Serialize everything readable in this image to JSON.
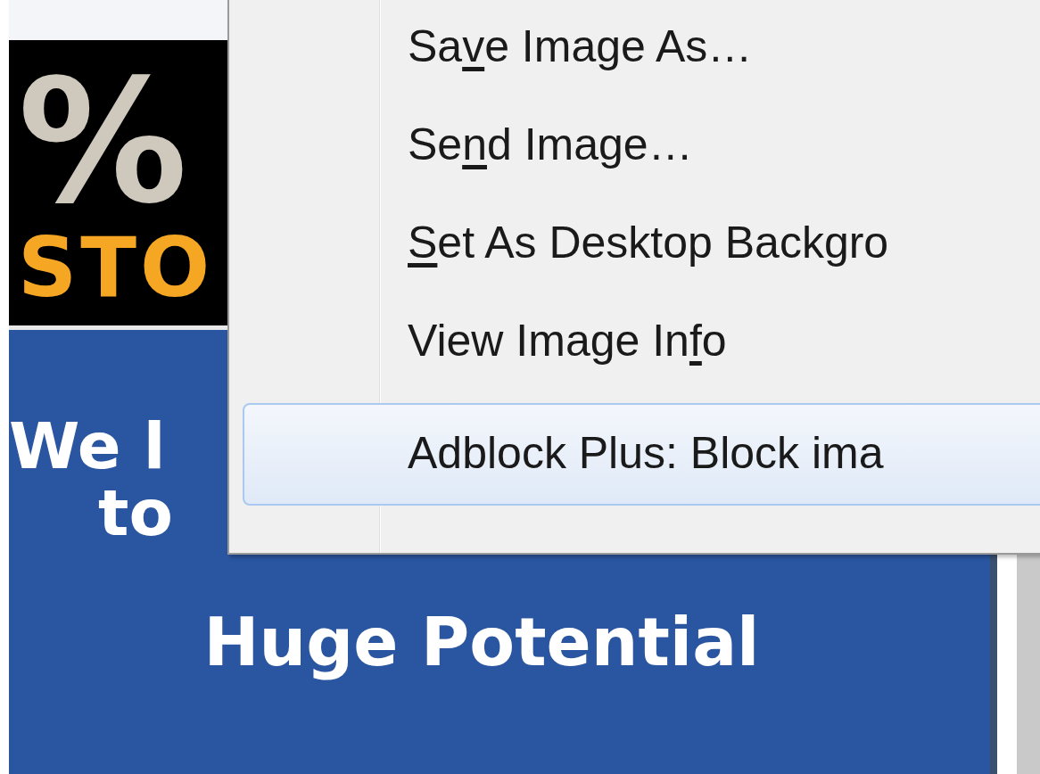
{
  "ad": {
    "symbol": "%",
    "brand": "STO",
    "line_1": "We l",
    "line_2": "to",
    "line_3": "Huge Potential"
  },
  "context_menu": {
    "items": [
      {
        "before": "Sa",
        "access_key": "v",
        "after": "e Image As…",
        "selected": false
      },
      {
        "before": "Se",
        "access_key": "n",
        "after": "d Image…",
        "selected": false
      },
      {
        "access_key": "S",
        "after": "et As Desktop Backgro",
        "selected": false
      },
      {
        "before": "View Image In",
        "access_key": "f",
        "after": "o",
        "selected": false
      },
      {
        "before": "Adblock Plus: Block ima",
        "selected": true
      }
    ]
  }
}
